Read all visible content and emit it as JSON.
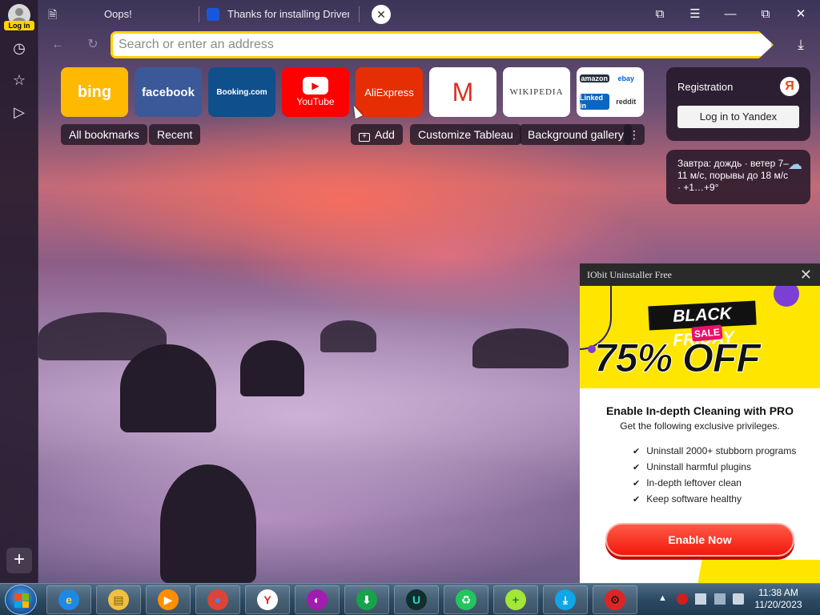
{
  "sidebar": {
    "login_label": "Log in",
    "icons": [
      "history-icon",
      "bookmarks-star-icon",
      "play-icon"
    ],
    "add_symbol": "+"
  },
  "tabs": [
    {
      "title": "Oops!"
    },
    {
      "title": "Thanks for installing Driver"
    }
  ],
  "window": {
    "close_tab_symbol": "✕",
    "collections_symbol": "⧉",
    "menu_symbol": "☰",
    "minimize_symbol": "—",
    "restore_symbol": "⧉",
    "close_symbol": "✕"
  },
  "addressbar": {
    "placeholder": "Search or enter an address",
    "back_symbol": "←",
    "reload_symbol": "↻",
    "download_symbol": "⤓"
  },
  "tiles": [
    {
      "label": "bing",
      "bg": "#ffb900",
      "color": "#ffffff"
    },
    {
      "label": "facebook",
      "bg": "#3b5998",
      "color": "#ffffff"
    },
    {
      "label": "Booking.com",
      "bg": "#0f4f8c",
      "color": "#ffffff"
    },
    {
      "label": "YouTube",
      "bg": "#ff0000",
      "color": "#ffffff"
    },
    {
      "label": "AliExpress",
      "bg": "#e62e04",
      "color": "#ffffff"
    },
    {
      "label": "M",
      "bg": "#ffffff",
      "color": "#d93025"
    },
    {
      "label": "Wikipedia",
      "bg": "#ffffff",
      "color": "#333333"
    }
  ],
  "tile_multi": [
    {
      "label": "amazon",
      "bg": "#232f3e",
      "color": "#ffffff"
    },
    {
      "label": "ebay",
      "bg": "#ffffff",
      "color": "#0064d2"
    },
    {
      "label": "Linked in",
      "bg": "#0a66c2",
      "color": "#ffffff"
    },
    {
      "label": "reddit",
      "bg": "#ffffff",
      "color": "#333333"
    }
  ],
  "bookmark_bar": {
    "all_bookmarks": "All bookmarks",
    "recent": "Recent",
    "add": "Add",
    "customize": "Customize Tableau",
    "background_gallery": "Background gallery",
    "more_symbol": "⋮"
  },
  "registration": {
    "title": "Registration",
    "logo": "Я",
    "login_button": "Log in to Yandex"
  },
  "weather": {
    "text": "Завтра: дождь · ветер 7–11 м/с, порывы до 18 м/с · +1…+9°",
    "icon": "☁"
  },
  "popup": {
    "window_title": "IObit Uninstaller Free",
    "close_symbol": "✕",
    "banner_top": "BLACK FRIDAY",
    "banner_sale": "SALE",
    "banner_off": "75% OFF",
    "title": "Enable In-depth Cleaning with PRO",
    "subtitle": "Get the following exclusive privileges.",
    "features": [
      "Uninstall 2000+ stubborn programs",
      "Uninstall harmful plugins",
      "In-depth leftover clean",
      "Keep software healthy"
    ],
    "cta": "Enable Now"
  },
  "taskbar": {
    "pinned": [
      {
        "name": "ie-icon",
        "glyph": "e",
        "bg": "#1e88e5",
        "color": "#ffd54f"
      },
      {
        "name": "file-explorer-icon",
        "glyph": "▤",
        "bg": "#f0c040",
        "color": "#7a5a10"
      },
      {
        "name": "media-player-icon",
        "glyph": "▶",
        "bg": "#ff8f00",
        "color": "#ffffff"
      },
      {
        "name": "chrome-icon",
        "glyph": "●",
        "bg": "#db4437",
        "color": "#4285f4"
      },
      {
        "name": "yandex-browser-icon",
        "glyph": "Y",
        "bg": "#ffffff",
        "color": "#e52620"
      },
      {
        "name": "iobit-app-icon",
        "glyph": "◐",
        "bg": "#a21caf",
        "color": "#ffffff"
      },
      {
        "name": "downloader-icon",
        "glyph": "⬇",
        "bg": "#16a34a",
        "color": "#ffffff"
      },
      {
        "name": "iobit-uninstaller-icon",
        "glyph": "U",
        "bg": "#0f2e2e",
        "color": "#2dd4bf"
      },
      {
        "name": "refresh-app-icon",
        "glyph": "♻",
        "bg": "#22c55e",
        "color": "#ffffff"
      },
      {
        "name": "add-app-icon",
        "glyph": "+",
        "bg": "#a3e635",
        "color": "#15803d"
      },
      {
        "name": "install-app-icon",
        "glyph": "⤓",
        "bg": "#0ea5e9",
        "color": "#ffffff"
      },
      {
        "name": "settings-app-icon",
        "glyph": "⚙",
        "bg": "#dc2626",
        "color": "#111111"
      }
    ],
    "tray_arrow": "▲",
    "time": "11:38 AM",
    "date": "11/20/2023"
  }
}
